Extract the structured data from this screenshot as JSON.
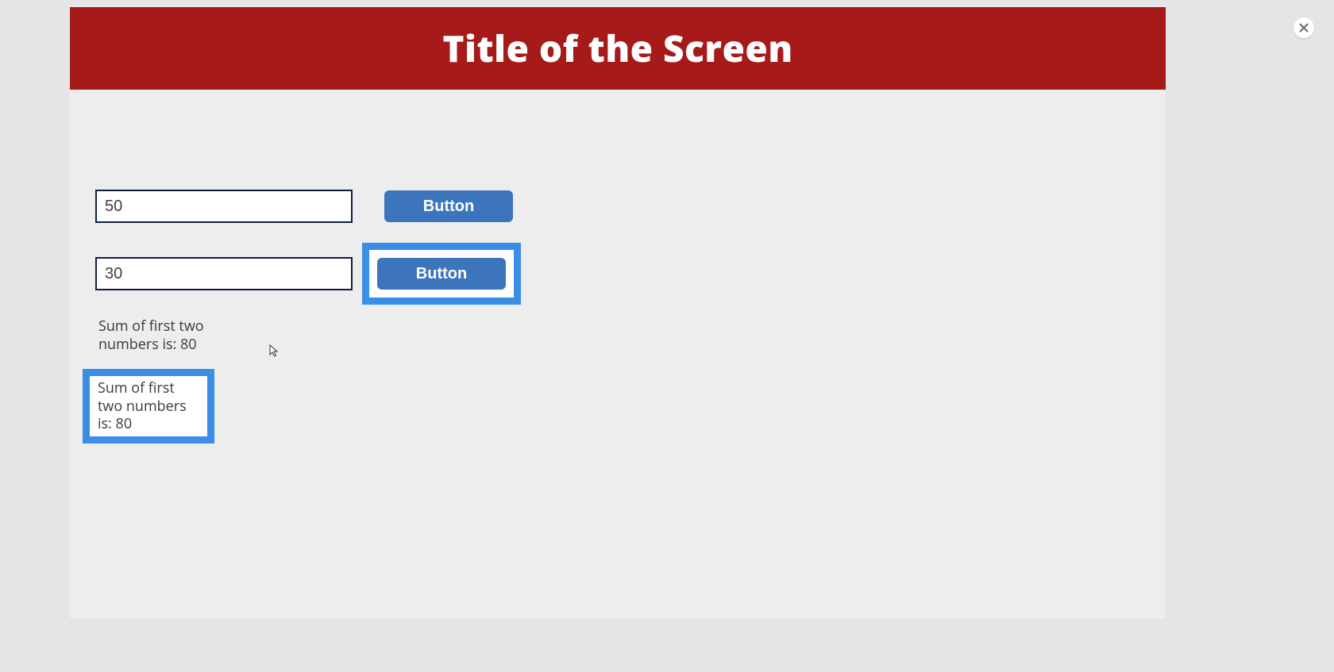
{
  "header": {
    "title": "Title of the Screen"
  },
  "inputs": {
    "first_value": "50",
    "second_value": "30"
  },
  "buttons": {
    "button1_label": "Button",
    "button2_label": "Button"
  },
  "result": {
    "label": "Sum of first two numbers is: ",
    "value": "80"
  },
  "result_highlighted": {
    "label": "Sum of first two numbers is: ",
    "value": "80"
  },
  "icons": {
    "close": "close-icon"
  }
}
